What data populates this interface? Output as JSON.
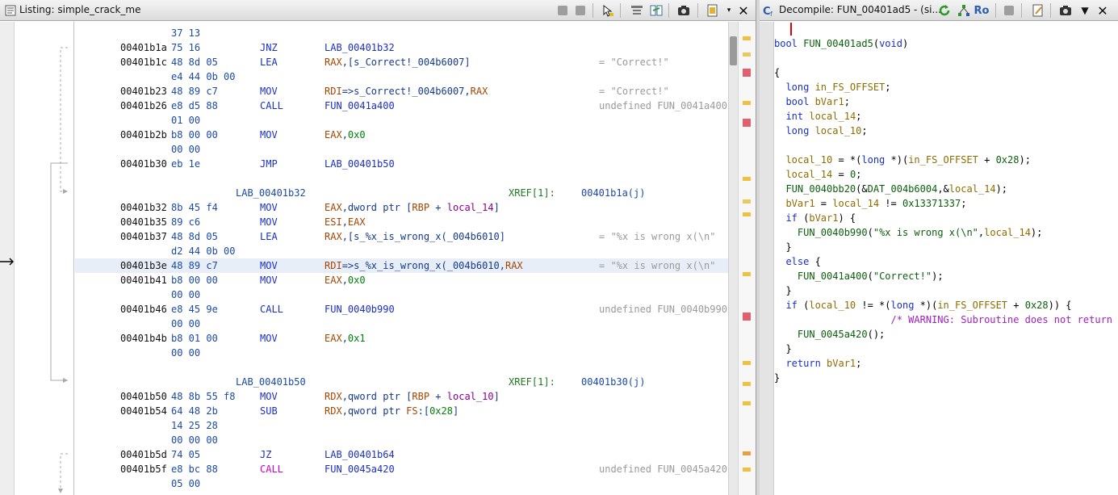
{
  "listing": {
    "title": "Listing:  simple_crack_me",
    "rows": [
      {
        "t": "bytes",
        "bytes": "37 13"
      },
      {
        "t": "ins",
        "addr": "00401b1a",
        "bytes": "75 16",
        "mnem": "JNZ",
        "ops": [
          {
            "c": "o-lab",
            "t": "LAB_00401b32"
          }
        ]
      },
      {
        "t": "ins",
        "addr": "00401b1c",
        "bytes": "48 8d 05",
        "mnem": "LEA",
        "ops": [
          {
            "c": "o-reg",
            "t": "RAX"
          },
          {
            "c": "",
            "t": ",[s_Correct!_004b6007]"
          }
        ],
        "cmt": "= \"Correct!\""
      },
      {
        "t": "bytes",
        "bytes": "e4 44 0b 00"
      },
      {
        "t": "ins",
        "addr": "00401b23",
        "bytes": "48 89 c7",
        "mnem": "MOV",
        "ops": [
          {
            "c": "o-reg",
            "t": "RDI"
          },
          {
            "c": "",
            "t": "=>s_Correct!_004b6007,"
          },
          {
            "c": "o-reg",
            "t": "RAX"
          }
        ],
        "cmt": "= \"Correct!\""
      },
      {
        "t": "ins",
        "addr": "00401b26",
        "bytes": "e8 d5 88",
        "mnem": "CALL",
        "ops": [
          {
            "c": "o-lab",
            "t": "FUN_0041a400"
          }
        ],
        "cmt": "undefined FUN_0041a400("
      },
      {
        "t": "bytes",
        "bytes": "01 00"
      },
      {
        "t": "ins",
        "addr": "00401b2b",
        "bytes": "b8 00 00",
        "mnem": "MOV",
        "ops": [
          {
            "c": "o-reg",
            "t": "EAX"
          },
          {
            "c": "",
            "t": ","
          },
          {
            "c": "o-scal",
            "t": "0x0"
          }
        ]
      },
      {
        "t": "bytes",
        "bytes": "00 00"
      },
      {
        "t": "ins",
        "addr": "00401b30",
        "bytes": "eb 1e",
        "mnem": "JMP",
        "ops": [
          {
            "c": "o-lab",
            "t": "LAB_00401b50"
          }
        ]
      },
      {
        "t": "blank"
      },
      {
        "t": "label",
        "label": "LAB_00401b32",
        "xref": "XREF[1]:",
        "xaddr": "00401b1a(j)"
      },
      {
        "t": "ins",
        "addr": "00401b32",
        "bytes": "8b 45 f4",
        "mnem": "MOV",
        "ops": [
          {
            "c": "o-reg",
            "t": "EAX"
          },
          {
            "c": "",
            "t": ",dword ptr ["
          },
          {
            "c": "o-reg",
            "t": "RBP"
          },
          {
            "c": "",
            "t": " + "
          },
          {
            "c": "o-var",
            "t": "local_14"
          },
          {
            "c": "",
            "t": "]"
          }
        ]
      },
      {
        "t": "ins",
        "addr": "00401b35",
        "bytes": "89 c6",
        "mnem": "MOV",
        "ops": [
          {
            "c": "o-reg",
            "t": "ESI"
          },
          {
            "c": "",
            "t": ","
          },
          {
            "c": "o-reg",
            "t": "EAX"
          }
        ]
      },
      {
        "t": "ins",
        "addr": "00401b37",
        "bytes": "48 8d 05",
        "mnem": "LEA",
        "ops": [
          {
            "c": "o-reg",
            "t": "RAX"
          },
          {
            "c": "",
            "t": ",[s_%x_is_wrong_x(_004b6010]"
          }
        ],
        "cmt": "= \"%x is wrong x(\\n\""
      },
      {
        "t": "bytes",
        "bytes": "d2 44 0b 00"
      },
      {
        "t": "ins",
        "sel": true,
        "addr": "00401b3e",
        "bytes": "48 89 c7",
        "mnem": "MOV",
        "ops": [
          {
            "c": "o-reg",
            "t": "RDI"
          },
          {
            "c": "",
            "t": "=>s_%x_is_wrong_x(_004b6010,"
          },
          {
            "c": "o-reg",
            "t": "RAX"
          }
        ],
        "cmt": "= \"%x is wrong x(\\n\""
      },
      {
        "t": "ins",
        "addr": "00401b41",
        "bytes": "b8 00 00",
        "mnem": "MOV",
        "ops": [
          {
            "c": "o-reg",
            "t": "EAX"
          },
          {
            "c": "",
            "t": ","
          },
          {
            "c": "o-scal",
            "t": "0x0"
          }
        ]
      },
      {
        "t": "bytes",
        "bytes": "00 00"
      },
      {
        "t": "ins",
        "addr": "00401b46",
        "bytes": "e8 45 9e",
        "mnem": "CALL",
        "ops": [
          {
            "c": "o-lab",
            "t": "FUN_0040b990"
          }
        ],
        "cmt": "undefined FUN_0040b990("
      },
      {
        "t": "bytes",
        "bytes": "00 00"
      },
      {
        "t": "ins",
        "addr": "00401b4b",
        "bytes": "b8 01 00",
        "mnem": "MOV",
        "ops": [
          {
            "c": "o-reg",
            "t": "EAX"
          },
          {
            "c": "",
            "t": ","
          },
          {
            "c": "o-scal",
            "t": "0x1"
          }
        ]
      },
      {
        "t": "bytes",
        "bytes": "00 00"
      },
      {
        "t": "blank"
      },
      {
        "t": "label",
        "label": "LAB_00401b50",
        "xref": "XREF[1]:",
        "xaddr": "00401b30(j)"
      },
      {
        "t": "ins",
        "addr": "00401b50",
        "bytes": "48 8b 55 f8",
        "mnem": "MOV",
        "ops": [
          {
            "c": "o-reg",
            "t": "RDX"
          },
          {
            "c": "",
            "t": ",qword ptr ["
          },
          {
            "c": "o-reg",
            "t": "RBP"
          },
          {
            "c": "",
            "t": " + "
          },
          {
            "c": "o-var",
            "t": "local_10"
          },
          {
            "c": "",
            "t": "]"
          }
        ]
      },
      {
        "t": "ins",
        "addr": "00401b54",
        "bytes": "64 48 2b",
        "mnem": "SUB",
        "ops": [
          {
            "c": "o-reg",
            "t": "RDX"
          },
          {
            "c": "",
            "t": ",qword ptr "
          },
          {
            "c": "o-reg",
            "t": "FS"
          },
          {
            "c": "",
            "t": ":["
          },
          {
            "c": "o-scal",
            "t": "0x28"
          },
          {
            "c": "",
            "t": "]"
          }
        ]
      },
      {
        "t": "bytes",
        "bytes": "14 25 28"
      },
      {
        "t": "bytes",
        "bytes": "00 00 00"
      },
      {
        "t": "ins",
        "addr": "00401b5d",
        "bytes": "74 05",
        "mnem": "JZ",
        "ops": [
          {
            "c": "o-lab",
            "t": "LAB_00401b64"
          }
        ]
      },
      {
        "t": "ins",
        "addr": "00401b5f",
        "bytes": "e8 bc 88",
        "mnem": "CALL",
        "call": true,
        "ops": [
          {
            "c": "o-lab",
            "t": "FUN_0045a420"
          }
        ],
        "cmt": "undefined FUN_0045a420("
      },
      {
        "t": "bytes",
        "bytes": "05 00"
      }
    ]
  },
  "decompile": {
    "title": "Decompile: FUN_00401ad5 -  (si...",
    "ro_label": "Ro",
    "lines": [
      {
        "n": "1",
        "s": []
      },
      {
        "n": "2",
        "s": [
          {
            "c": "kw",
            "t": "bool"
          },
          {
            "c": "fn",
            "t": " FUN_00401ad5"
          },
          {
            "c": "",
            "t": "("
          },
          {
            "c": "kw",
            "t": "void"
          },
          {
            "c": "",
            "t": ")"
          }
        ]
      },
      {
        "n": "3",
        "s": []
      },
      {
        "n": "4",
        "s": [
          {
            "c": "",
            "t": "{"
          }
        ]
      },
      {
        "n": "5",
        "s": [
          {
            "c": "",
            "t": "  "
          },
          {
            "c": "kw",
            "t": "long"
          },
          {
            "c": "dv",
            "t": " in_FS_OFFSET"
          },
          {
            "c": "",
            "t": ";"
          }
        ]
      },
      {
        "n": "6",
        "s": [
          {
            "c": "",
            "t": "  "
          },
          {
            "c": "kw",
            "t": "bool"
          },
          {
            "c": "dv",
            "t": " bVar1"
          },
          {
            "c": "",
            "t": ";"
          }
        ]
      },
      {
        "n": "7",
        "s": [
          {
            "c": "",
            "t": "  "
          },
          {
            "c": "kw",
            "t": "int"
          },
          {
            "c": "dv",
            "t": " local_14"
          },
          {
            "c": "",
            "t": ";"
          }
        ]
      },
      {
        "n": "8",
        "s": [
          {
            "c": "",
            "t": "  "
          },
          {
            "c": "kw",
            "t": "long"
          },
          {
            "c": "dv",
            "t": " local_10"
          },
          {
            "c": "",
            "t": ";"
          }
        ]
      },
      {
        "n": "9",
        "s": [
          {
            "c": "",
            "t": "  "
          }
        ]
      },
      {
        "n": "10",
        "s": [
          {
            "c": "",
            "t": "  "
          },
          {
            "c": "dv",
            "t": "local_10"
          },
          {
            "c": "",
            "t": " = *("
          },
          {
            "c": "kw",
            "t": "long"
          },
          {
            "c": "",
            "t": " *)("
          },
          {
            "c": "dv",
            "t": "in_FS_OFFSET"
          },
          {
            "c": "",
            "t": " + "
          },
          {
            "c": "num",
            "t": "0x28"
          },
          {
            "c": "",
            "t": ");"
          }
        ]
      },
      {
        "n": "11",
        "s": [
          {
            "c": "",
            "t": "  "
          },
          {
            "c": "dv",
            "t": "local_14"
          },
          {
            "c": "",
            "t": " = "
          },
          {
            "c": "num",
            "t": "0"
          },
          {
            "c": "",
            "t": ";"
          }
        ]
      },
      {
        "n": "12",
        "s": [
          {
            "c": "",
            "t": "  "
          },
          {
            "c": "fn",
            "t": "FUN_0040bb20"
          },
          {
            "c": "",
            "t": "(&"
          },
          {
            "c": "gl",
            "t": "DAT_004b6004"
          },
          {
            "c": "",
            "t": ",&"
          },
          {
            "c": "dv",
            "t": "local_14"
          },
          {
            "c": "",
            "t": ");"
          }
        ]
      },
      {
        "n": "13",
        "s": [
          {
            "c": "",
            "t": "  "
          },
          {
            "c": "dv",
            "t": "bVar1"
          },
          {
            "c": "",
            "t": " = "
          },
          {
            "c": "dv",
            "t": "local_14"
          },
          {
            "c": "",
            "t": " != "
          },
          {
            "c": "num",
            "t": "0x13371337"
          },
          {
            "c": "",
            "t": ";"
          }
        ]
      },
      {
        "n": "14",
        "s": [
          {
            "c": "",
            "t": "  "
          },
          {
            "c": "kw",
            "t": "if"
          },
          {
            "c": "",
            "t": " ("
          },
          {
            "c": "dv",
            "t": "bVar1"
          },
          {
            "c": "",
            "t": ") {"
          }
        ]
      },
      {
        "n": "15",
        "s": [
          {
            "c": "",
            "t": "    "
          },
          {
            "c": "fn",
            "t": "FUN_0040b990"
          },
          {
            "c": "",
            "t": "("
          },
          {
            "c": "str",
            "t": "\"%x is wrong x(\\n\""
          },
          {
            "c": "",
            "t": ","
          },
          {
            "c": "dv",
            "t": "local_14"
          },
          {
            "c": "",
            "t": ");"
          }
        ]
      },
      {
        "n": "16",
        "s": [
          {
            "c": "",
            "t": "  }"
          }
        ]
      },
      {
        "n": "17",
        "s": [
          {
            "c": "",
            "t": "  "
          },
          {
            "c": "kw",
            "t": "else"
          },
          {
            "c": "",
            "t": " {"
          }
        ]
      },
      {
        "n": "18",
        "s": [
          {
            "c": "",
            "t": "    "
          },
          {
            "c": "fn",
            "t": "FUN_0041a400"
          },
          {
            "c": "",
            "t": "("
          },
          {
            "c": "str",
            "t": "\"Correct!\""
          },
          {
            "c": "",
            "t": ");"
          }
        ]
      },
      {
        "n": "19",
        "s": [
          {
            "c": "",
            "t": "  }"
          }
        ]
      },
      {
        "n": "20",
        "s": [
          {
            "c": "",
            "t": "  "
          },
          {
            "c": "kw",
            "t": "if"
          },
          {
            "c": "",
            "t": " ("
          },
          {
            "c": "dv",
            "t": "local_10"
          },
          {
            "c": "",
            "t": " != *("
          },
          {
            "c": "kw",
            "t": "long"
          },
          {
            "c": "",
            "t": " *)("
          },
          {
            "c": "dv",
            "t": "in_FS_OFFSET"
          },
          {
            "c": "",
            "t": " + "
          },
          {
            "c": "num",
            "t": "0x28"
          },
          {
            "c": "",
            "t": ")) {"
          }
        ]
      },
      {
        "n": "21",
        "s": [
          {
            "c": "cm",
            "t": "                    /* WARNING: Subroutine does not return */"
          }
        ]
      },
      {
        "n": "22",
        "s": [
          {
            "c": "",
            "t": "    "
          },
          {
            "c": "fn",
            "t": "FUN_0045a420"
          },
          {
            "c": "",
            "t": "();"
          }
        ]
      },
      {
        "n": "23",
        "s": [
          {
            "c": "",
            "t": "  }"
          }
        ]
      },
      {
        "n": "24",
        "s": [
          {
            "c": "",
            "t": "  "
          },
          {
            "c": "kw",
            "t": "return"
          },
          {
            "c": "dv",
            "t": " bVar1"
          },
          {
            "c": "",
            "t": ";"
          }
        ]
      },
      {
        "n": "25",
        "s": [
          {
            "c": "",
            "t": "}"
          }
        ]
      },
      {
        "n": "26",
        "s": []
      }
    ]
  },
  "overview_marks": [
    {
      "color": "#f0c040"
    },
    {
      "color": "#e8c860"
    },
    {
      "color": "#e06070"
    },
    {
      "color": "#f0c040"
    },
    {
      "color": "#e06070"
    },
    {
      "color": "#f0c040"
    },
    {
      "color": "#e8c860"
    },
    {
      "color": "#f0c040"
    },
    {
      "color": "#f0c040"
    },
    {
      "color": "#e06070"
    },
    {
      "color": "#f0c040"
    },
    {
      "color": "#f0c040"
    },
    {
      "color": "#f0c040"
    },
    {
      "color": "#e8a040"
    },
    {
      "color": "#f0c040"
    }
  ]
}
